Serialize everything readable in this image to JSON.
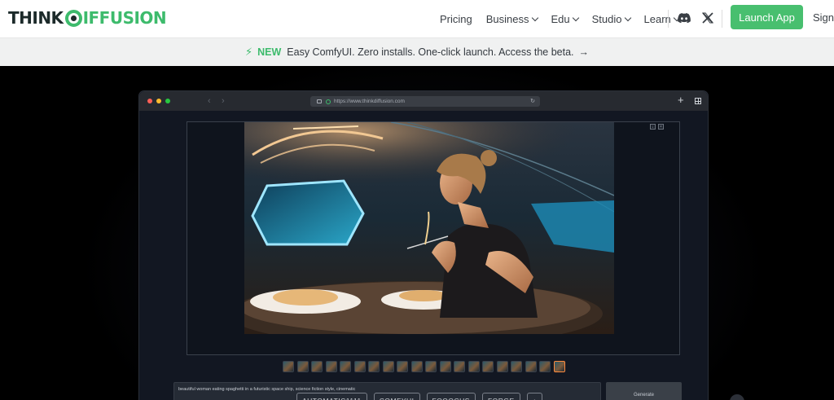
{
  "nav": {
    "logo_text_1": "THINK",
    "logo_text_2": "IFFUSION",
    "links": [
      {
        "label": "Pricing",
        "has_dropdown": false
      },
      {
        "label": "Business",
        "has_dropdown": true
      },
      {
        "label": "Edu",
        "has_dropdown": true
      },
      {
        "label": "Studio",
        "has_dropdown": true
      },
      {
        "label": "Learn",
        "has_dropdown": true
      }
    ],
    "discord_icon": "discord-icon",
    "x_icon": "x-twitter-icon",
    "launch_label": "Launch App",
    "signin_label": "Sign"
  },
  "banner": {
    "new_label": "NEW",
    "text": "Easy ComfyUI. Zero installs. One-click launch. Access the beta.",
    "arrow": "→"
  },
  "browser": {
    "url": "https://www.thinkdiffusion.com",
    "prompt_text": "beautiful woman eating spaghetti in a futuristic space ship, science fiction style, cinematic",
    "generate_label": "Generate",
    "thumbnail_count": 20,
    "selected_thumbnail": 20
  },
  "ui_tabs": [
    "AUTOMATIC1111",
    "COMFYUI",
    "FOOOCUS",
    "FORGE",
    "+"
  ],
  "colors": {
    "brand_green": "#48bf6f",
    "hero_bg": "#000000",
    "banner_bg": "#f0f1f1"
  }
}
